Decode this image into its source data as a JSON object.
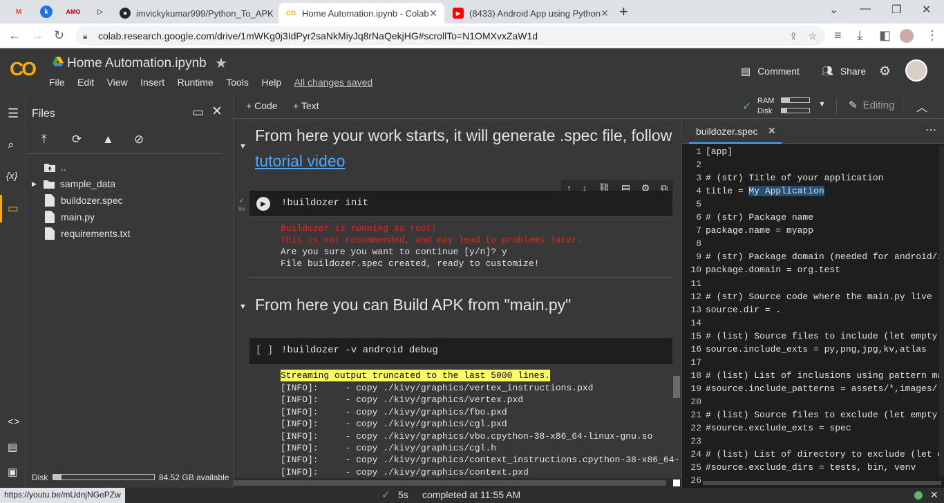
{
  "browser": {
    "tabs": [
      {
        "title": "imvickykumar999/Python_To_APK",
        "icon": "github-icon",
        "active": false
      },
      {
        "title": "Home Automation.ipynb - Colab",
        "icon": "colab-icon",
        "active": true
      },
      {
        "title": "(8433) Android App using Python",
        "icon": "youtube-icon",
        "active": false
      }
    ],
    "pinned": [
      "gmail-icon",
      "k-icon",
      "amo-icon",
      "play-icon"
    ],
    "new_tab": "+",
    "url": "colab.research.google.com/drive/1mWKg0j3IdPyr2saNkMiyJq8rNaQekjHG#scrollTo=N1OMXvxZaW1d"
  },
  "colab": {
    "logo": "CO",
    "title": "Home Automation.ipynb",
    "menu": [
      "File",
      "Edit",
      "View",
      "Insert",
      "Runtime",
      "Tools",
      "Help"
    ],
    "saved": "All changes saved",
    "comment": "Comment",
    "share": "Share"
  },
  "toolbar": {
    "code": "+ Code",
    "text": "+ Text",
    "ram": "RAM",
    "disk": "Disk",
    "ram_fill": 0.3,
    "disk_fill": 0.2,
    "editing": "Editing"
  },
  "files_panel": {
    "title": "Files",
    "items": [
      {
        "name": "..",
        "type": "parent"
      },
      {
        "name": "sample_data",
        "type": "folder"
      },
      {
        "name": "buildozer.spec",
        "type": "file"
      },
      {
        "name": "main.py",
        "type": "file"
      },
      {
        "name": "requirements.txt",
        "type": "file"
      }
    ],
    "disk_label": "Disk",
    "disk_available": "84.52 GB available",
    "disk_fill": 0.08
  },
  "notebook": {
    "heading1_a": "From here your work starts, it will generate .spec file, follow",
    "heading1_link": "tutorial video",
    "cell1_code": "!buildozer init",
    "cell1_exec": "0s",
    "cell1_output": [
      {
        "text": "Buildozer is running as root!",
        "color": "#e8271b"
      },
      {
        "text": "This is not recommended, and may lead to problems later.",
        "color": "#e8271b"
      },
      {
        "text": "Are you sure you want to continue [y/n]? y",
        "color": "#e3e3e3"
      },
      {
        "text": "File buildozer.spec created, ready to customize!",
        "color": "#e3e3e3"
      }
    ],
    "heading2": "From here you can Build APK from \"main.py\"",
    "cell2_prompt": "[ ]",
    "cell2_code": "!buildozer -v android debug",
    "cell2_banner": "Streaming output truncated to the last 5000 lines.",
    "cell2_output": [
      "[INFO]:     - copy ./kivy/graphics/vertex_instructions.pxd",
      "[INFO]:     - copy ./kivy/graphics/vertex.pxd",
      "[INFO]:     - copy ./kivy/graphics/fbo.pxd",
      "[INFO]:     - copy ./kivy/graphics/cgl.pxd",
      "[INFO]:     - copy ./kivy/graphics/vbo.cpython-38-x86_64-linux-gnu.so",
      "[INFO]:     - copy ./kivy/graphics/cgl.h",
      "[INFO]:     - copy ./kivy/graphics/context_instructions.cpython-38-x86_64-",
      "[INFO]:     - copy ./kivy/graphics/context.pxd"
    ]
  },
  "editor": {
    "tab": "buildozer.spec",
    "lines": [
      "[app]",
      "",
      "# (str) Title of your application",
      "title = My Application",
      "",
      "# (str) Package name",
      "package.name = myapp",
      "",
      "# (str) Package domain (needed for android/io",
      "package.domain = org.test",
      "",
      "# (str) Source code where the main.py live",
      "source.dir = .",
      "",
      "# (list) Source files to include (let empty t",
      "source.include_exts = py,png,jpg,kv,atlas",
      "",
      "# (list) List of inclusions using pattern mat",
      "#source.include_patterns = assets/*,images/*.",
      "",
      "# (list) Source files to exclude (let empty t",
      "#source.exclude_exts = spec",
      "",
      "# (list) List of directory to exclude (let em",
      "#source.exclude_dirs = tests, bin, venv",
      ""
    ]
  },
  "status": {
    "link": "https://youtu.be/mUdnjNGePZw",
    "time": "5s",
    "message": "completed at 11:55 AM"
  }
}
